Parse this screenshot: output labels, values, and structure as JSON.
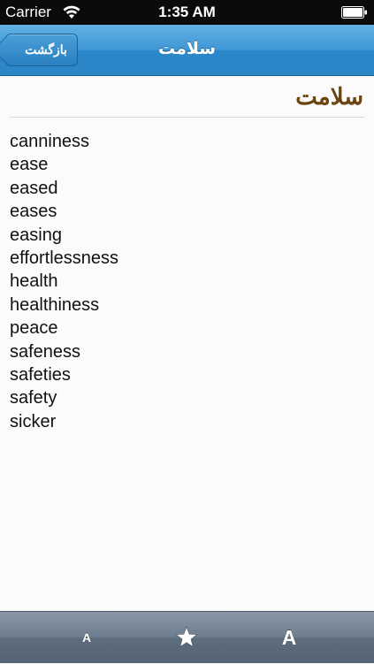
{
  "status_bar": {
    "carrier": "Carrier",
    "time": "1:35 AM"
  },
  "nav_bar": {
    "back_label": "بازگشت",
    "title": "سلامت"
  },
  "entry": {
    "word": "سلامت",
    "translations": [
      "canniness",
      "ease",
      "eased",
      "eases",
      "easing",
      "effortlessness",
      "health",
      "healthiness",
      "peace",
      "safeness",
      "safeties",
      "safety",
      "sicker"
    ]
  },
  "toolbar": {
    "font_small_label": "A",
    "favorite_icon": "star-icon",
    "font_large_label": "A"
  },
  "colors": {
    "nav_accent": "#2d86c7",
    "word_heading": "#6b4410",
    "toolbar": "#6e7e8f"
  }
}
